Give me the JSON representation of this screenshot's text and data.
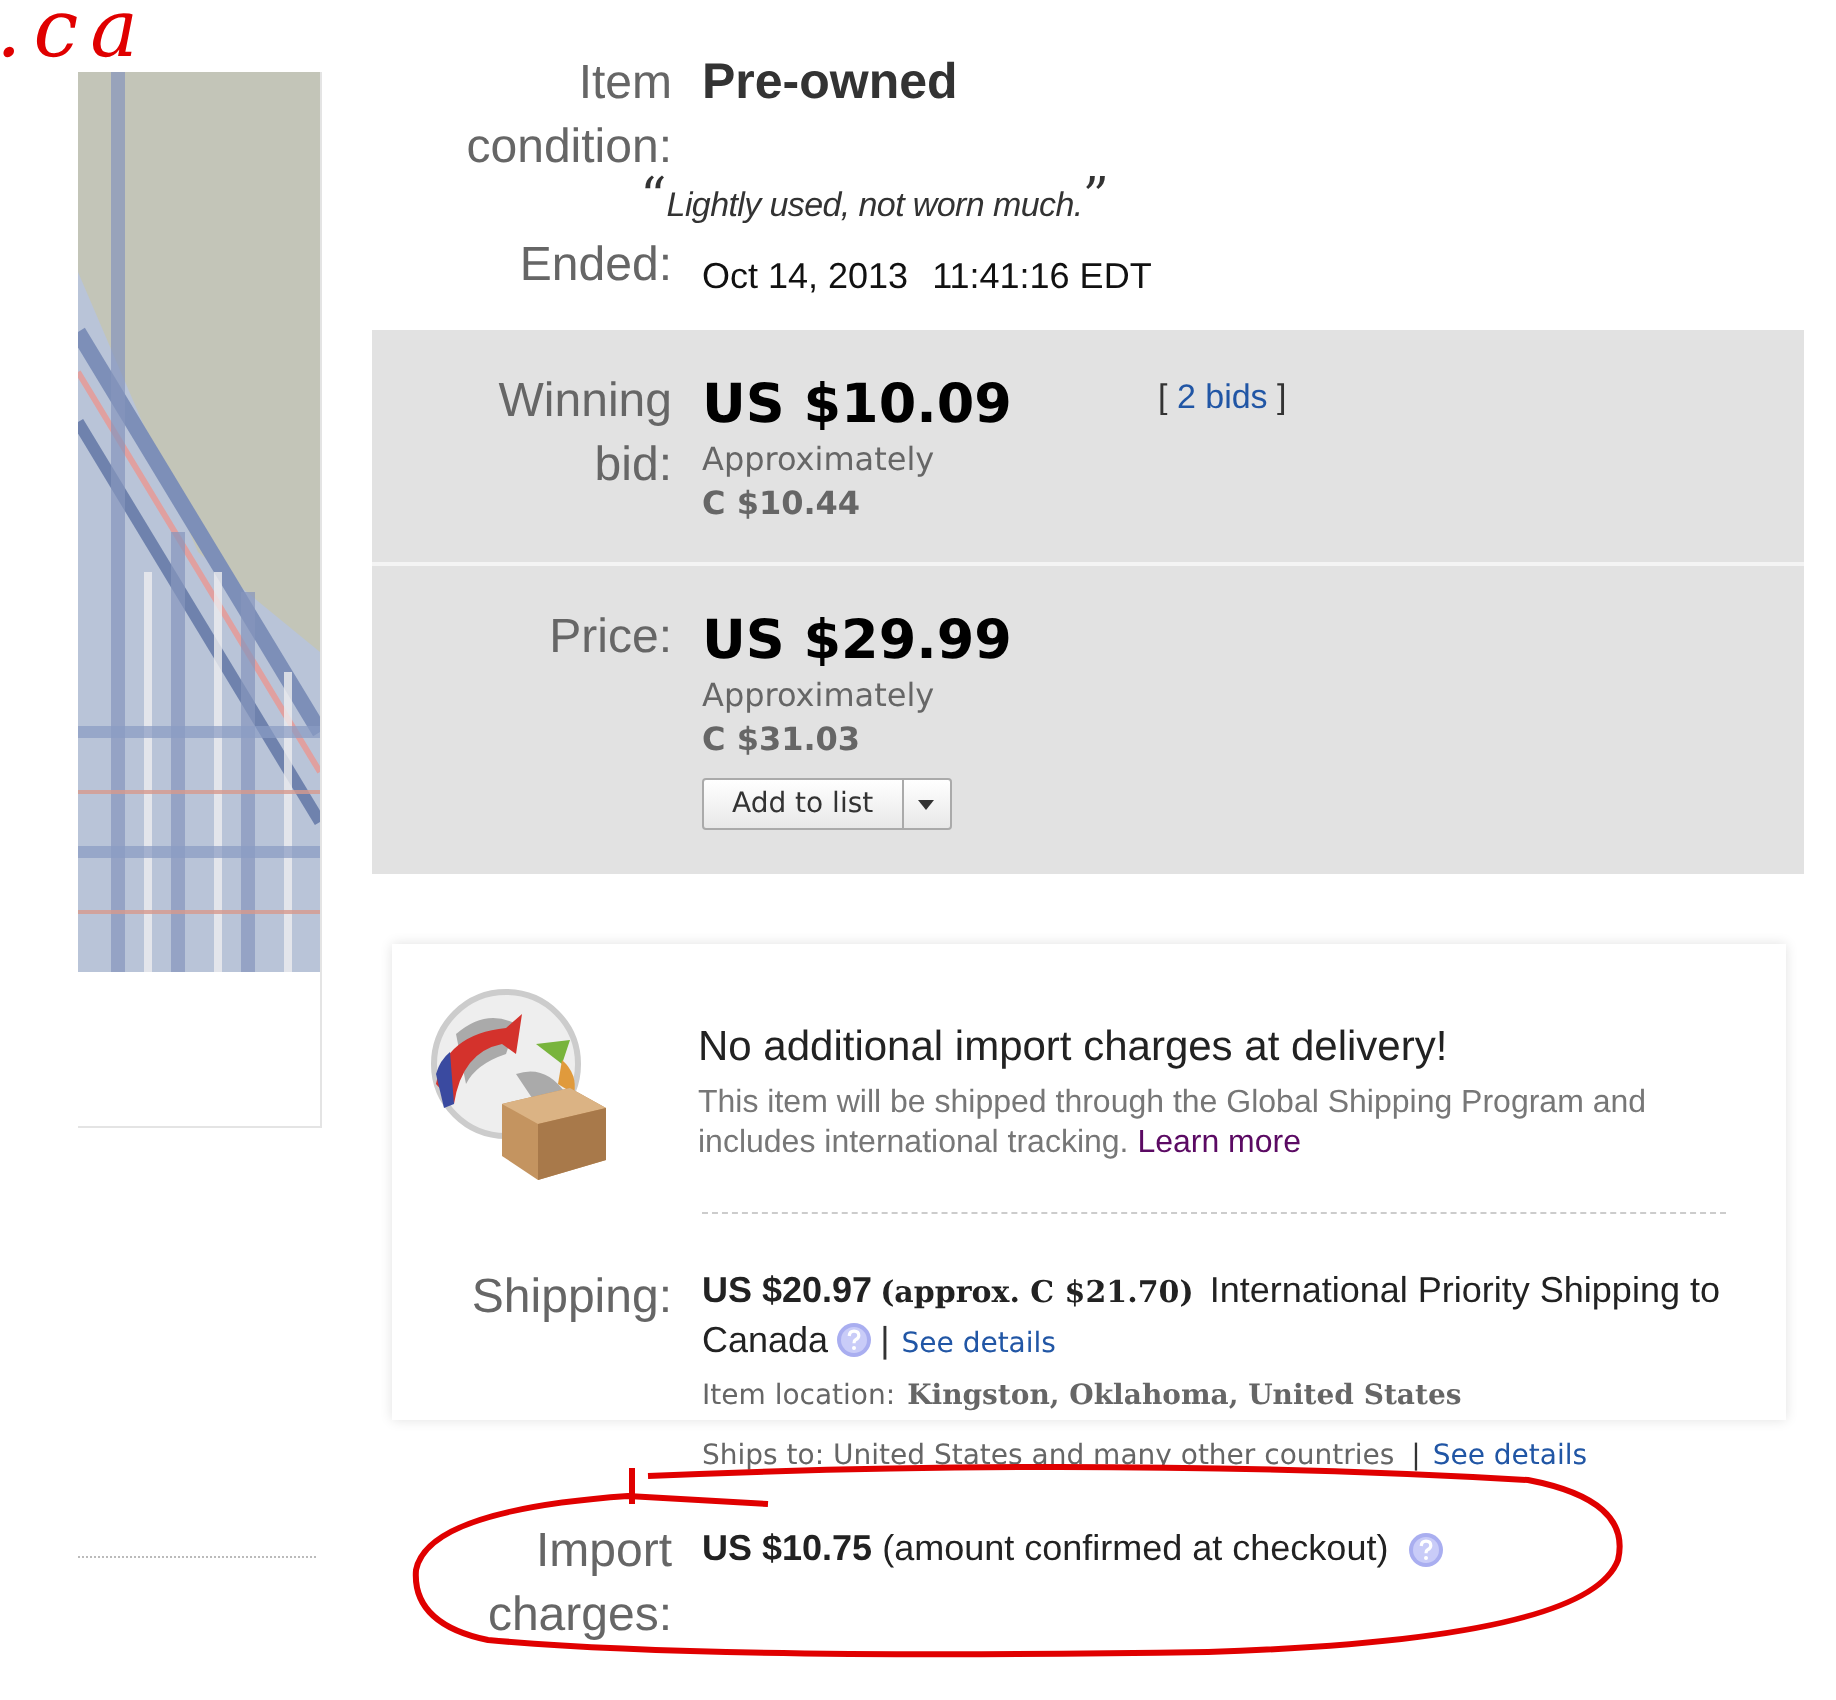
{
  "annotation": {
    "text": ".ca"
  },
  "condition": {
    "label": "Item condition:",
    "value": "Pre-owned",
    "quote_open": "“",
    "quote": "Lightly used, not worn much.",
    "quote_close": "”"
  },
  "ended": {
    "label": "Ended:",
    "date": "Oct 14, 2013",
    "time": "11:41:16 EDT"
  },
  "winning_bid": {
    "label": "Winning bid:",
    "amount": "US $10.09",
    "approx_label": "Approximately",
    "approx": "C $10.44",
    "bids_open": "[",
    "bids_link": "2 bids",
    "bids_close": "]"
  },
  "price": {
    "label": "Price:",
    "amount": "US $29.99",
    "approx_label": "Approximately",
    "approx": "C $31.03",
    "button": "Add to list"
  },
  "gsp": {
    "title": "No additional import charges at delivery!",
    "text": "This item will be shipped through the Global Shipping Program and includes international tracking.",
    "link": "Learn more"
  },
  "shipping": {
    "label": "Shipping:",
    "amount": "US $20.97",
    "approx": "(approx. C $21.70)",
    "service": "International Priority Shipping to Canada",
    "separator": "|",
    "details_link": "See details",
    "location_label": "Item location:",
    "location": "Kingston, Oklahoma, United States"
  },
  "ships_to": {
    "label": "Ships to:",
    "value": "United States and many other countries",
    "separator": "|",
    "details_link": "See details"
  },
  "import": {
    "label": "Import charges:",
    "amount": "US $10.75",
    "note": "(amount confirmed at checkout)"
  }
}
